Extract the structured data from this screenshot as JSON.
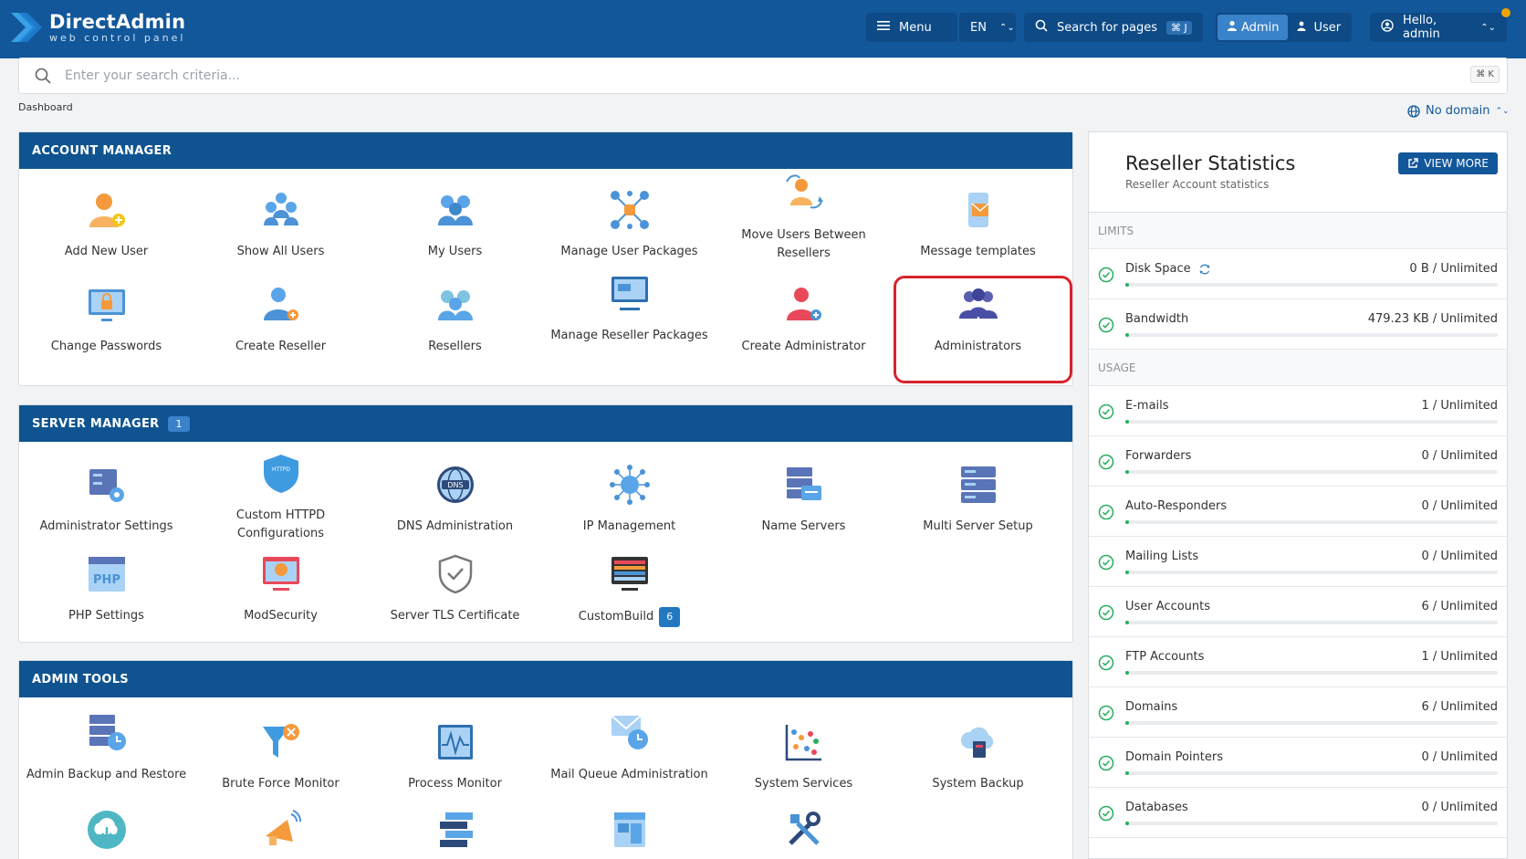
{
  "header": {
    "logo_title": "DirectAdmin",
    "logo_sub": "web control panel",
    "menu_label": "Menu",
    "lang_label": "EN",
    "search_pages_label": "Search for pages",
    "search_pages_kbd": "⌘ J",
    "role_admin": "Admin",
    "role_user": "User",
    "hello_label": "Hello, admin"
  },
  "search": {
    "placeholder": "Enter your search criteria...",
    "kbd": "⌘ K"
  },
  "breadcrumb": "Dashboard",
  "domain_select": "No domain",
  "account_manager": {
    "title": "ACCOUNT MANAGER",
    "items": [
      {
        "label": "Add New User"
      },
      {
        "label": "Show All Users"
      },
      {
        "label": "My Users"
      },
      {
        "label": "Manage User Packages"
      },
      {
        "label": "Move Users Between Resellers"
      },
      {
        "label": "Message templates"
      },
      {
        "label": "Change Passwords"
      },
      {
        "label": "Create Reseller"
      },
      {
        "label": "Resellers"
      },
      {
        "label": "Manage Reseller Packages"
      },
      {
        "label": "Create Administrator"
      },
      {
        "label": "Administrators"
      }
    ]
  },
  "server_manager": {
    "title": "SERVER MANAGER",
    "badge": "1",
    "items": [
      {
        "label": "Administrator Settings"
      },
      {
        "label": "Custom HTTPD Configurations"
      },
      {
        "label": "DNS Administration"
      },
      {
        "label": "IP Management"
      },
      {
        "label": "Name Servers"
      },
      {
        "label": "Multi Server Setup"
      },
      {
        "label": "PHP Settings"
      },
      {
        "label": "ModSecurity"
      },
      {
        "label": "Server TLS Certificate"
      },
      {
        "label": "CustomBuild",
        "badge": "6"
      }
    ]
  },
  "admin_tools": {
    "title": "ADMIN TOOLS",
    "items": [
      {
        "label": "Admin Backup and Restore"
      },
      {
        "label": "Brute Force Monitor"
      },
      {
        "label": "Process Monitor"
      },
      {
        "label": "Mail Queue Administration"
      },
      {
        "label": "System Services"
      },
      {
        "label": "System Backup"
      }
    ]
  },
  "reseller_stats": {
    "title": "Reseller Statistics",
    "subtitle": "Reseller Account statistics",
    "view_more": "VIEW MORE",
    "limits_label": "LIMITS",
    "usage_label": "USAGE",
    "limits": [
      {
        "name": "Disk Space",
        "value": "0 B / Unlimited",
        "fill": 0
      },
      {
        "name": "Bandwidth",
        "value": "479.23 KB / Unlimited",
        "fill": 0
      }
    ],
    "usage": [
      {
        "name": "E-mails",
        "value": "1 / Unlimited",
        "fill": 0
      },
      {
        "name": "Forwarders",
        "value": "0 / Unlimited",
        "fill": 0
      },
      {
        "name": "Auto-Responders",
        "value": "0 / Unlimited",
        "fill": 0
      },
      {
        "name": "Mailing Lists",
        "value": "0 / Unlimited",
        "fill": 0
      },
      {
        "name": "User Accounts",
        "value": "6 / Unlimited",
        "fill": 0
      },
      {
        "name": "FTP Accounts",
        "value": "1 / Unlimited",
        "fill": 0
      },
      {
        "name": "Domains",
        "value": "6 / Unlimited",
        "fill": 0
      },
      {
        "name": "Domain Pointers",
        "value": "0 / Unlimited",
        "fill": 0
      },
      {
        "name": "Databases",
        "value": "0 / Unlimited",
        "fill": 0
      }
    ]
  },
  "colors": {
    "primary": "#12579a",
    "panel_head": "#0f5490",
    "accent": "#3a82c9",
    "highlight": "#d9232d",
    "ok": "#27ae60"
  }
}
